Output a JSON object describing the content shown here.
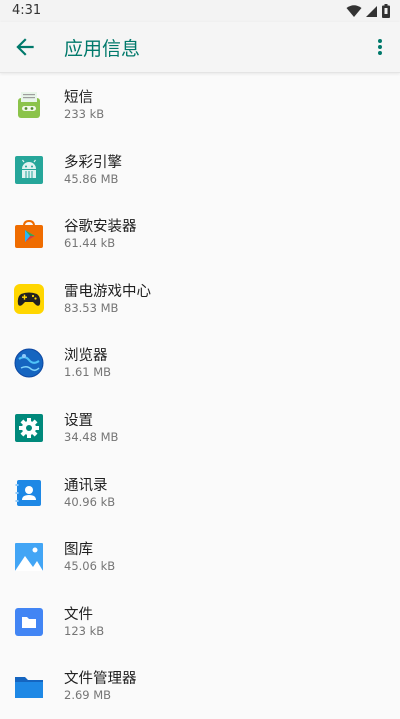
{
  "status_bar": {
    "time": "4:31",
    "icons": [
      "wifi-icon",
      "signal-icon",
      "battery-icon"
    ]
  },
  "app_bar": {
    "title": "应用信息",
    "icons": {
      "back": "arrow-back-icon",
      "more": "more-vert-icon"
    },
    "accent_color": "#00796b"
  },
  "apps": [
    {
      "name": "短信",
      "size": "233 kB",
      "icon": "sms-icon"
    },
    {
      "name": "多彩引擎",
      "size": "45.86 MB",
      "icon": "android-icon"
    },
    {
      "name": "谷歌安装器",
      "size": "61.44 kB",
      "icon": "google-installer-icon"
    },
    {
      "name": "雷电游戏中心",
      "size": "83.53 MB",
      "icon": "gamepad-icon"
    },
    {
      "name": "浏览器",
      "size": "1.61 MB",
      "icon": "browser-globe-icon"
    },
    {
      "name": "设置",
      "size": "34.48 MB",
      "icon": "settings-gear-icon"
    },
    {
      "name": "通讯录",
      "size": "40.96 kB",
      "icon": "contacts-icon"
    },
    {
      "name": "图库",
      "size": "45.06 kB",
      "icon": "gallery-icon"
    },
    {
      "name": "文件",
      "size": "123 kB",
      "icon": "files-icon"
    },
    {
      "name": "文件管理器",
      "size": "2.69 MB",
      "icon": "file-manager-icon"
    }
  ]
}
